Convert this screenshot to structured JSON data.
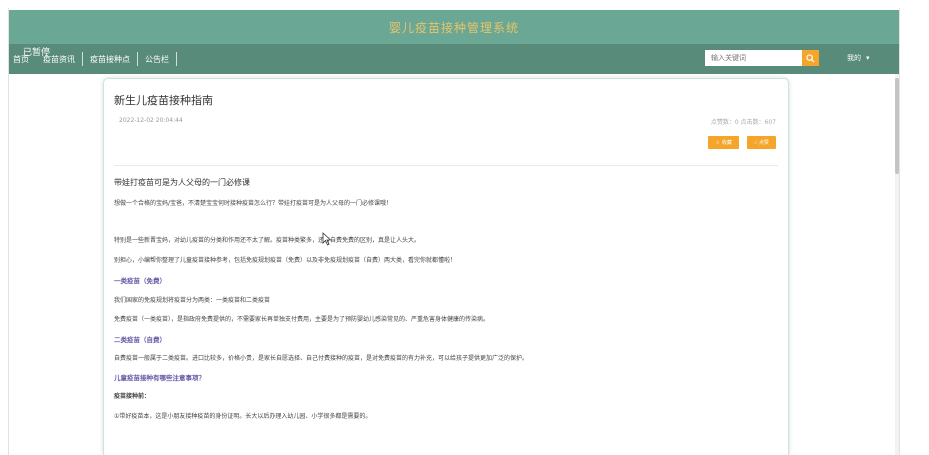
{
  "header": {
    "title": "婴儿疫苗接种管理系统"
  },
  "nav": {
    "overlay_text": "已暂停",
    "items": [
      {
        "label": "首页"
      },
      {
        "label": "疫苗资讯"
      },
      {
        "label": "疫苗接种点"
      },
      {
        "label": "公告栏"
      }
    ]
  },
  "search": {
    "placeholder": "输入关键词"
  },
  "user": {
    "label": "我的"
  },
  "article": {
    "title": "新生儿疫苗接种指南",
    "date": "2022-12-02 20:04:44",
    "stats": "点赞数：0   点击数：607",
    "collect_label": "收藏",
    "like_label": "点赞",
    "lines": [
      "带娃打疫苗可是为人父母的一门必修课",
      "想做一个合格的宝妈/宝爸，不清楚宝宝何时接种疫苗怎么行？带娃打疫苗可是为人父母的一门必修课哦！",
      "特别是一些新晋宝妈，对幼儿疫苗的分类和作用还不太了解。疫苗种类繁多，还有自费免费的区别，真是让人头大。",
      "别担心，小编帮你整理了儿童疫苗接种参考，包括免疫规划疫苗（免费）以及非免疫规划疫苗（自费）两大类，看完你就都懂啦！",
      "一类疫苗（免费）",
      "我们国家的免疫规划将疫苗分为两类：一类疫苗和二类疫苗",
      "免费疫苗（一类疫苗），是指政府免费提供的，不需要家长再单独支付费用，主要是为了预防婴幼儿感染常见的、严重危害身体健康的传染病。",
      "二类疫苗（自费）",
      "自费疫苗一般属于二类疫苗。进口比较多，价格小贵，是家长自愿选择、自己付费接种的疫苗，是对免费疫苗的有力补充，可以给孩子提供更加广泛的保护。",
      "儿童疫苗接种有哪些注意事项？",
      "疫苗接种前：",
      "①带好疫苗本，这是小朋友接种疫苗的身份证明。长大以后办理入幼儿园、小学很多都是需要的。"
    ]
  },
  "colors": {
    "title_bar": "#6aa794",
    "nav_bar": "#588b79",
    "title_text": "#e8c46a",
    "accent": "#f4a52a",
    "purple_heading": "#6559a6"
  }
}
